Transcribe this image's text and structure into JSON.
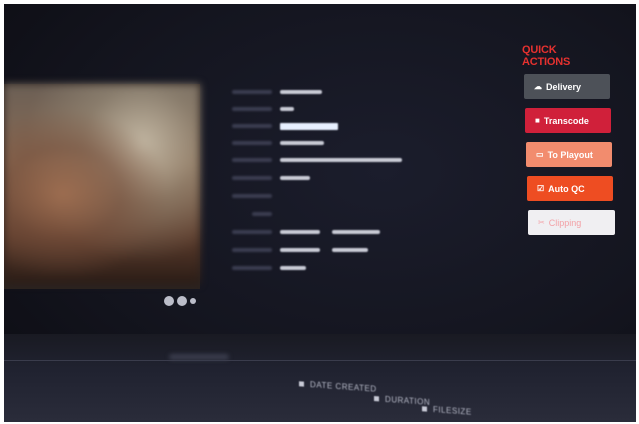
{
  "quick_actions": {
    "title": "QUICK ACTIONS",
    "buttons": [
      {
        "label": "Delivery",
        "icon": "cloud-upload-icon",
        "color": "#4d5158"
      },
      {
        "label": "Transcode",
        "icon": "film-icon",
        "color": "#d0203a"
      },
      {
        "label": "To Playout",
        "icon": "monitor-icon",
        "color": "#f28c6e"
      },
      {
        "label": "Auto QC",
        "icon": "checkbox-icon",
        "color": "#ee4d22"
      },
      {
        "label": "Clipping",
        "icon": "scissors-icon",
        "color": "#f0eff2"
      }
    ]
  },
  "table_header": {
    "columns": [
      "DATE CREATED",
      "DURATION",
      "FILESIZE"
    ]
  },
  "colors": {
    "accent": "#e5312f",
    "background": "#14151f"
  }
}
